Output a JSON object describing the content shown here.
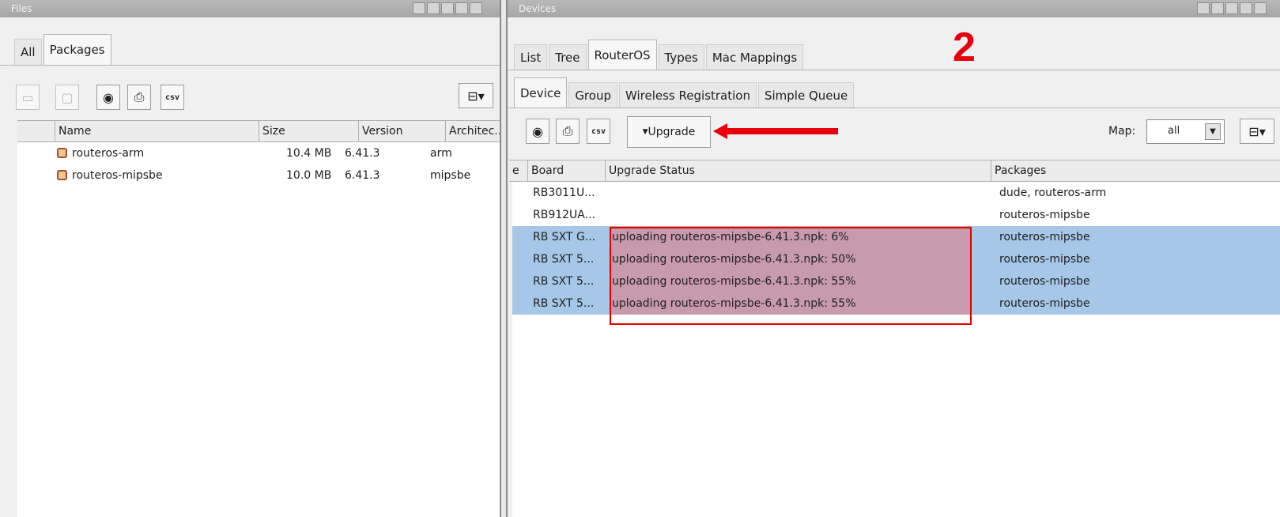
{
  "left_panel": {
    "title": "Files",
    "tabs": [
      {
        "label": "All"
      },
      {
        "label": "Packages"
      }
    ],
    "columns": [
      "Name",
      "Size",
      "Version",
      "Architec..."
    ],
    "rows": [
      {
        "name": "routeros-arm",
        "size": "10.4 MB",
        "version": "6.41.3",
        "arch": "arm"
      },
      {
        "name": "routeros-mipsbe",
        "size": "10.0 MB",
        "version": "6.41.3",
        "arch": "mipsbe"
      }
    ],
    "toolbar": {
      "find_icon": "binoculars-icon",
      "print_icon": "printer-icon",
      "csv_label": "csv"
    }
  },
  "right_panel": {
    "title": "Devices",
    "tabs": [
      {
        "label": "List"
      },
      {
        "label": "Tree"
      },
      {
        "label": "RouterOS"
      },
      {
        "label": "Types"
      },
      {
        "label": "Mac Mappings"
      }
    ],
    "subtabs": [
      {
        "label": "Device"
      },
      {
        "label": "Group"
      },
      {
        "label": "Wireless Registration"
      },
      {
        "label": "Simple Queue"
      }
    ],
    "toolbar": {
      "csv_label": "csv",
      "upgrade_label": "Upgrade",
      "map_label": "Map:",
      "map_value": "all"
    },
    "columns": [
      "e",
      "Board",
      "Upgrade Status",
      "Packages"
    ],
    "rows": [
      {
        "board": "RB3011U...",
        "status": "",
        "packages": "dude, routeros-arm",
        "selected": false
      },
      {
        "board": "RB912UA...",
        "status": "",
        "packages": "routeros-mipsbe",
        "selected": false
      },
      {
        "board": "RB SXT G...",
        "status": "uploading routeros-mipsbe-6.41.3.npk: 6%",
        "packages": "routeros-mipsbe",
        "selected": true
      },
      {
        "board": "RB SXT 5...",
        "status": "uploading routeros-mipsbe-6.41.3.npk: 50%",
        "packages": "routeros-mipsbe",
        "selected": true
      },
      {
        "board": "RB SXT 5...",
        "status": "uploading routeros-mipsbe-6.41.3.npk: 55%",
        "packages": "routeros-mipsbe",
        "selected": true
      },
      {
        "board": "RB SXT 5...",
        "status": "uploading routeros-mipsbe-6.41.3.npk: 55%",
        "packages": "routeros-mipsbe",
        "selected": true
      }
    ]
  },
  "annotations": {
    "step_number": "2",
    "color": "#e8000c"
  }
}
